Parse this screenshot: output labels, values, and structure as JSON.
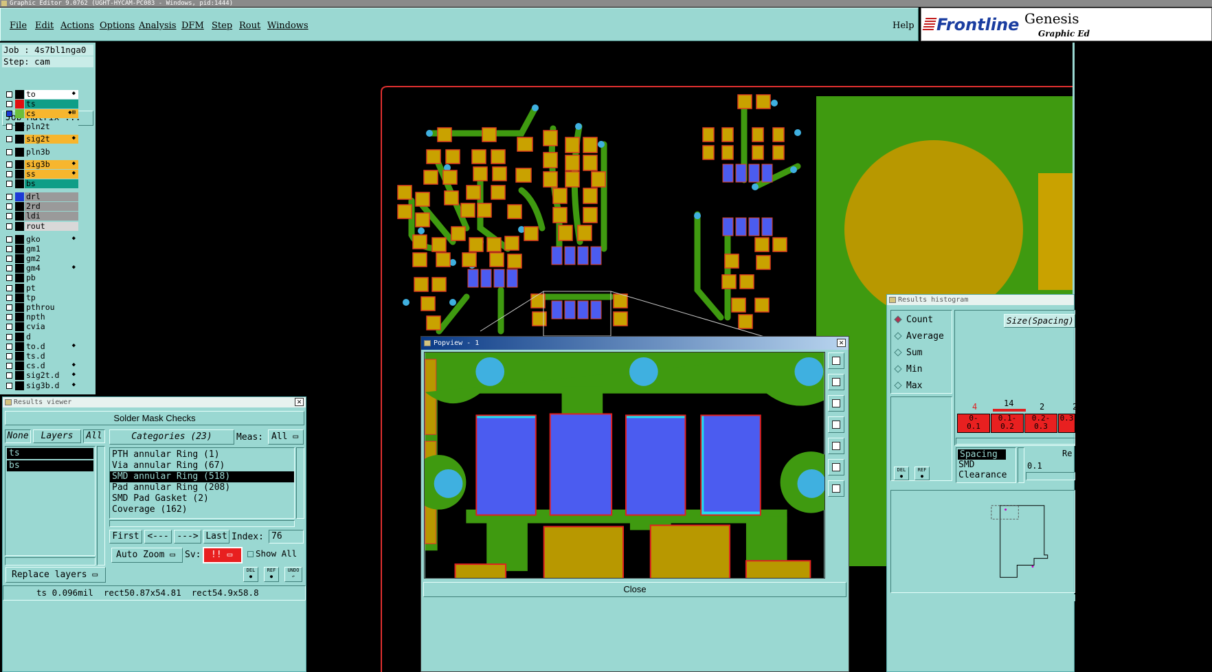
{
  "window": {
    "title": "Graphic Editor 9.0762  (UGHT-HYCAM-PC083 - Windows, pid:1444)"
  },
  "menu": {
    "items": [
      "File",
      "Edit",
      "Actions",
      "Options",
      "Analysis",
      "DFM",
      "Step",
      "Rout",
      "Windows"
    ],
    "help": "Help"
  },
  "brand": {
    "logo": "Frontline",
    "product": "Genesis",
    "subtitle": "Graphic Ed"
  },
  "job": {
    "job_line": "Job : 4s7bl1nga0",
    "step_line": "Step: cam",
    "matrix_button": "Job Matrix ..."
  },
  "layers": [
    {
      "name": "to",
      "color": "#ffffff",
      "swatch": "#000000",
      "mark": "◆"
    },
    {
      "name": "ts",
      "color": "#0f9e87",
      "swatch": "#e01010",
      "mark": ""
    },
    {
      "name": "cs",
      "color": "#f7b62e",
      "swatch": "#6bbf3a",
      "mark": "◆⊞"
    },
    {
      "name": "pln2t",
      "color": "#9ad8d2",
      "swatch": "#000000",
      "mark": ""
    },
    {
      "name": "sig2t",
      "color": "#f7b62e",
      "swatch": "#000000",
      "mark": "◆"
    },
    {
      "name": "pln3b",
      "color": "#9ad8d2",
      "swatch": "#000000",
      "mark": ""
    },
    {
      "name": "sig3b",
      "color": "#f7b62e",
      "swatch": "#000000",
      "mark": "◆"
    },
    {
      "name": "ss",
      "color": "#f7b62e",
      "swatch": "#000000",
      "mark": "◆"
    },
    {
      "name": "bs",
      "color": "#0f9e87",
      "swatch": "#000000",
      "mark": ""
    },
    {
      "name": "drl",
      "color": "#9a9a9a",
      "swatch": "#1c3ad6",
      "mark": ""
    },
    {
      "name": "2rd",
      "color": "#9a9a9a",
      "swatch": "#000000",
      "mark": ""
    },
    {
      "name": "ldi",
      "color": "#9a9a9a",
      "swatch": "#000000",
      "mark": ""
    },
    {
      "name": "rout",
      "color": "#d8d8d8",
      "swatch": "#000000",
      "mark": ""
    },
    {
      "name": "gko",
      "color": "#9ad8d2",
      "swatch": "#000000",
      "mark": "◆"
    },
    {
      "name": "gm1",
      "color": "#9ad8d2",
      "swatch": "#000000",
      "mark": ""
    },
    {
      "name": "gm2",
      "color": "#9ad8d2",
      "swatch": "#000000",
      "mark": ""
    },
    {
      "name": "gm4",
      "color": "#9ad8d2",
      "swatch": "#000000",
      "mark": "◆"
    },
    {
      "name": "pb",
      "color": "#9ad8d2",
      "swatch": "#000000",
      "mark": ""
    },
    {
      "name": "pt",
      "color": "#9ad8d2",
      "swatch": "#000000",
      "mark": ""
    },
    {
      "name": "tp",
      "color": "#9ad8d2",
      "swatch": "#000000",
      "mark": ""
    },
    {
      "name": "pthrou",
      "color": "#9ad8d2",
      "swatch": "#000000",
      "mark": ""
    },
    {
      "name": "npth",
      "color": "#9ad8d2",
      "swatch": "#000000",
      "mark": ""
    },
    {
      "name": "cvia",
      "color": "#9ad8d2",
      "swatch": "#000000",
      "mark": ""
    },
    {
      "name": "d",
      "color": "#9ad8d2",
      "swatch": "#000000",
      "mark": ""
    },
    {
      "name": "to.d",
      "color": "#9ad8d2",
      "swatch": "#000000",
      "mark": "◆"
    },
    {
      "name": "ts.d",
      "color": "#9ad8d2",
      "swatch": "#000000",
      "mark": ""
    },
    {
      "name": "cs.d",
      "color": "#9ad8d2",
      "swatch": "#000000",
      "mark": "◆"
    },
    {
      "name": "sig2t.d",
      "color": "#9ad8d2",
      "swatch": "#000000",
      "mark": "◆"
    },
    {
      "name": "sig3b.d",
      "color": "#9ad8d2",
      "swatch": "#000000",
      "mark": "◆"
    }
  ],
  "results_viewer": {
    "title": "Results viewer",
    "heading": "Solder Mask Checks",
    "none_label": "None",
    "layers_label": "Layers",
    "all_label": "All",
    "layer_list": [
      "ts",
      "bs"
    ],
    "categories_label": "Categories (23)",
    "meas_label": "Meas:",
    "meas_value": "All",
    "categories": [
      "PTH annular Ring (1)",
      "Via annular Ring (67)",
      "SMD annular Ring (518)",
      "Pad annular Ring (208)",
      "SMD Pad Gasket (2)",
      "Coverage (162)"
    ],
    "selected_category": 2,
    "nav": {
      "first": "First",
      "prev": "<---",
      "next": "--->",
      "last": "Last",
      "index_label": "Index:",
      "index_value": "76"
    },
    "auto_zoom": "Auto Zoom",
    "sv_label": "Sv:",
    "sv_value": "!!",
    "show_all": "Show All",
    "replace_layers": "Replace layers",
    "status": "ts 0.096mil  rect50.87x54.81  rect54.9x58.8"
  },
  "popview": {
    "title": "Popview - 1",
    "close": "Close"
  },
  "histogram": {
    "title": "Results histogram",
    "modes": [
      "Count",
      "Average",
      "Sum",
      "Min",
      "Max"
    ],
    "selected_mode": "Count",
    "axis_title": "Size(Spacing)",
    "counts": [
      "4",
      "14",
      "2",
      "2"
    ],
    "bins": [
      "0-\n0.1",
      "0.1-\n0.2",
      "0.2-\n0.3",
      "0.3"
    ],
    "types": [
      "Spacing",
      "SMD",
      "Clearance"
    ],
    "re_label": "Re",
    "value": "0.1"
  }
}
